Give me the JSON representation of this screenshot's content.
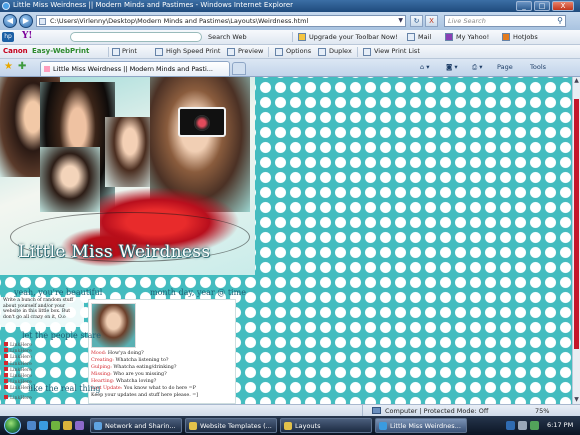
{
  "window": {
    "title": "Little Miss Weirdness || Modern Minds and Pastimes - Windows Internet Explorer",
    "minimize": "_",
    "maximize": "□",
    "close": "X"
  },
  "address": {
    "url": "C:\\Users\\Virlenny\\Desktop\\Modern Minds and Pastimes\\Layouts\\Weirdness.html",
    "search_placeholder": "Live Search",
    "refresh": "↻",
    "stop": "X"
  },
  "toolbar1": {
    "yahoo": "Y!",
    "search_web": "Search Web",
    "upgrade": "Upgrade your Toolbar Now!",
    "mail": "Mail",
    "my_yahoo": "My Yahoo!",
    "hotjobs": "HotJobs"
  },
  "toolbar2": {
    "canon": "Canon",
    "webprint": "Easy-WebPrint",
    "print": "Print",
    "hs_print": "High Speed Print",
    "preview": "Preview",
    "options": "Options",
    "duplex": "Duplex",
    "print_list": "View Print List"
  },
  "tabs": {
    "active": "Little Miss Weirdness || Modern Minds and Pasti...",
    "page_menu": "Page",
    "tools_menu": "Tools"
  },
  "site": {
    "logo": "Little Miss Weirdness",
    "header_left": "yeah, you're beautiful",
    "header_right": "month day, year @ time",
    "intro": "Write a bunch of random stuff about yourself and/or your website in this little box. But don't go all crazy on it, O.o",
    "section1": "let the people stare",
    "section2": "like the real thing",
    "links": [
      "LinkHere",
      "LinkHere",
      "LinkHere",
      "LinkHere",
      "LinkHere",
      "LinkHere",
      "LinkHere",
      "LinkHere"
    ],
    "links2": [
      "LinkHere"
    ],
    "mood": [
      {
        "k": "Mood:",
        "v": "How'ya doing?"
      },
      {
        "k": "Creating:",
        "v": "Whatcha listening to?"
      },
      {
        "k": "Gulping:",
        "v": "Whatcha eating/drinking?"
      },
      {
        "k": "Missing:",
        "v": "Who are you missing?"
      },
      {
        "k": "Hearting:",
        "v": "Whatcha loving?"
      },
      {
        "k": "Last Update:",
        "v": "You know what to do here =P"
      }
    ],
    "keep": "Keep your updates and stuff here please. =]"
  },
  "status": {
    "zone": "Computer | Protected Mode: Off",
    "zoom": "75%"
  },
  "taskbar": {
    "items": [
      "Network and Sharin...",
      "Website Templates (...",
      "Layouts",
      "Little Miss Weirdnes..."
    ],
    "clock": "6:17 PM"
  }
}
